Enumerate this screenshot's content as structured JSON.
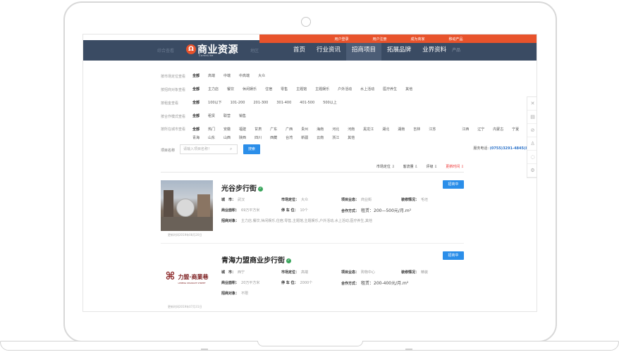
{
  "topbar": {
    "links": [
      "用户登录",
      "用户注册",
      "成为商家",
      "移动产品"
    ]
  },
  "nav": {
    "logo_text": "商业资源",
    "logo_sub": "ComeLike",
    "ghost_items": [
      "综合查看",
      "地区",
      "找写字",
      "全部",
      "商业综合体",
      "招商",
      "商业街"
    ],
    "menu": [
      "首页",
      "行业资讯",
      "招商项目",
      "拓展品牌",
      "业界资料"
    ],
    "active_index": 2,
    "trail_fragment": "产品"
  },
  "filters": [
    {
      "label": "按市场定位查看",
      "options": [
        "全部",
        "高端",
        "中端",
        "中高端",
        "大众"
      ]
    },
    {
      "label": "按招商对象查看",
      "options": [
        "全部",
        "主力店",
        "餐饮",
        "休闲娱乐",
        "住宿",
        "零售",
        "主题馆",
        "主题娱乐",
        "户外活动",
        "水上活动",
        "医疗养生",
        "其他"
      ]
    },
    {
      "label": "按租金查看",
      "options": [
        "全部",
        "100以下",
        "101-200",
        "201-300",
        "301-400",
        "401-500",
        "500以上"
      ]
    },
    {
      "label": "按合作模式查看",
      "options": [
        "全部",
        "租赁",
        "联营",
        "销售"
      ]
    },
    {
      "label": "按所在城市查看",
      "options": [
        "全部",
        "热门",
        "安徽",
        "福建",
        "甘肃",
        "广东",
        "广西",
        "贵州",
        "海南",
        "河北",
        "河南",
        "黑龙江",
        "湖北",
        "湖南",
        "吉林",
        "江苏",
        "江西",
        "辽宁",
        "内蒙古",
        "宁夏",
        "青海",
        "山东",
        "山西",
        "陕西",
        "四川",
        "西藏",
        "台湾",
        "新疆",
        "云南",
        "浙江",
        "其他"
      ]
    }
  ],
  "search": {
    "label": "项目名称",
    "placeholder": "请输入项目名称！",
    "button": "搜索",
    "phone_label": "服务电话:",
    "phone": "(0755)3291-4845(888)"
  },
  "sort": [
    "市场定位 ⇩",
    "客流量 ⇩",
    "评级 ⇩",
    "更新时间 ⇩"
  ],
  "listings": [
    {
      "title": "光谷步行街",
      "button": "招商中",
      "updated": "更新时间2019年08月20日",
      "fields": {
        "city_k": "城　市：",
        "city_v": "武汉",
        "position_k": "市场定位：",
        "position_v": "大众",
        "format_k": "项目业态：",
        "format_v": "商业街",
        "decor_k": "装修情况：",
        "decor_v": "毛坯",
        "area_k": "商业面积：",
        "area_v": "69万平方米",
        "parking_k": "停 车 位：",
        "parking_v": "10个",
        "coop_k": "合作方式：",
        "coop_v": "租赁：200—500元/月.m²",
        "target_k": "招商对象：",
        "target_v": "主力店,餐饮,休闲娱乐,住宿,零售,主题馆,主题娱乐,户外活动,水上活动,医疗养生,其他"
      }
    },
    {
      "title": "青海力盟商业步行街",
      "button": "招商中",
      "updated": "更新时间2019年07月31日",
      "logo_text": "力盟·商業巷",
      "logo_caption": "LIMENG SHANGYE STREET",
      "fields": {
        "city_k": "城　市：",
        "city_v": "西宁",
        "position_k": "市场定位：",
        "position_v": "高端",
        "format_k": "项目业态：",
        "format_v": "购物中心",
        "decor_k": "装修情况：",
        "decor_v": "精装",
        "area_k": "商业面积：",
        "area_v": "20万平方米",
        "parking_k": "停 车 位：",
        "parking_v": "2000个",
        "coop_k": "合作方式：",
        "coop_v": "租赁：200-400元/月.m²",
        "target_k": "招商对象：",
        "target_v": "不限"
      }
    }
  ],
  "side_tools": [
    "close-icon",
    "doc-icon",
    "compass-icon",
    "user-icon",
    "chat-icon",
    "gear-icon"
  ]
}
